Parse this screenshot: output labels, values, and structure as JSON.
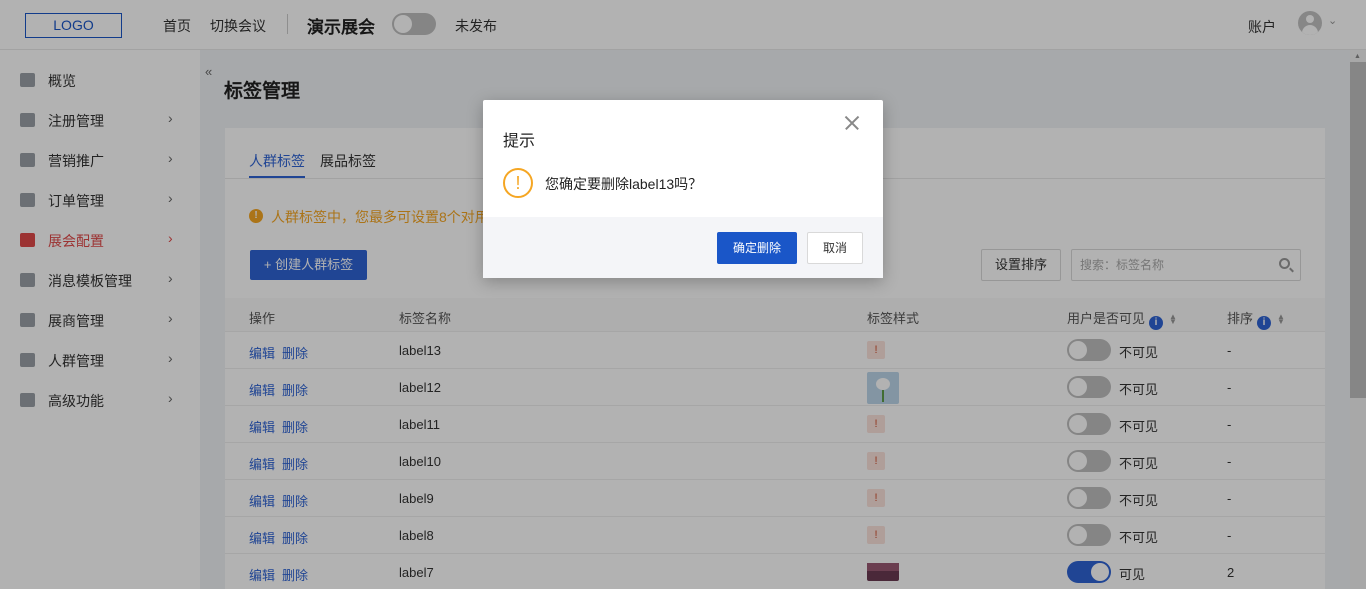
{
  "header": {
    "logo": "LOGO",
    "nav": [
      "首页",
      "切换会议"
    ],
    "conference_title": "演示展会",
    "publish_status": "未发布",
    "account": "账户"
  },
  "sidebar": {
    "collapse": "«",
    "items": [
      {
        "label": "概览",
        "icon": "overview-icon",
        "arrow": ""
      },
      {
        "label": "注册管理",
        "icon": "registration-icon",
        "arrow": "›"
      },
      {
        "label": "营销推广",
        "icon": "marketing-icon",
        "arrow": "›"
      },
      {
        "label": "订单管理",
        "icon": "order-icon",
        "arrow": "›"
      },
      {
        "label": "展会配置",
        "icon": "config-icon",
        "arrow": "›",
        "active": true
      },
      {
        "label": "消息模板管理",
        "icon": "bell-icon",
        "arrow": "›"
      },
      {
        "label": "展商管理",
        "icon": "exhibitor-icon",
        "arrow": "›"
      },
      {
        "label": "人群管理",
        "icon": "people-icon",
        "arrow": "›"
      },
      {
        "label": "高级功能",
        "icon": "tag-icon",
        "arrow": "›"
      }
    ]
  },
  "main": {
    "title": "标签管理",
    "tabs": [
      "人群标签",
      "展品标签"
    ],
    "notice": "人群标签中，您最多可设置8个对用",
    "create_button": "+ 创建人群标签",
    "sort_button": "设置排序",
    "search_placeholder": "搜索：标签名称",
    "columns": [
      "操作",
      "标签名称",
      "标签样式",
      "用户是否可见",
      "排序"
    ],
    "info_mark": "i",
    "rows": [
      {
        "edit": "编辑",
        "delete": "删除",
        "name": "label13",
        "style": "tag",
        "tag_text": "!",
        "visible": false,
        "visible_text": "不可见",
        "order": "-"
      },
      {
        "edit": "编辑",
        "delete": "删除",
        "name": "label12",
        "style": "flower-image",
        "visible": false,
        "visible_text": "不可见",
        "order": "-"
      },
      {
        "edit": "编辑",
        "delete": "删除",
        "name": "label11",
        "style": "tag",
        "tag_text": "!",
        "visible": false,
        "visible_text": "不可见",
        "order": "-"
      },
      {
        "edit": "编辑",
        "delete": "删除",
        "name": "label10",
        "style": "tag",
        "tag_text": "!",
        "visible": false,
        "visible_text": "不可见",
        "order": "-"
      },
      {
        "edit": "编辑",
        "delete": "删除",
        "name": "label9",
        "style": "tag",
        "tag_text": "!",
        "visible": false,
        "visible_text": "不可见",
        "order": "-"
      },
      {
        "edit": "编辑",
        "delete": "删除",
        "name": "label8",
        "style": "tag",
        "tag_text": "!",
        "visible": false,
        "visible_text": "不可见",
        "order": "-"
      },
      {
        "edit": "编辑",
        "delete": "删除",
        "name": "label7",
        "style": "sunset-image",
        "visible": true,
        "visible_text": "可见",
        "order": "2"
      }
    ]
  },
  "dialog": {
    "title": "提示",
    "icon_glyph": "!",
    "message": "您确定要删除label13吗？",
    "confirm": "确定删除",
    "cancel": "取消"
  },
  "colors": {
    "accent": "#2e63d4",
    "active_menu": "#e04a4a",
    "warning": "#f5a623"
  }
}
